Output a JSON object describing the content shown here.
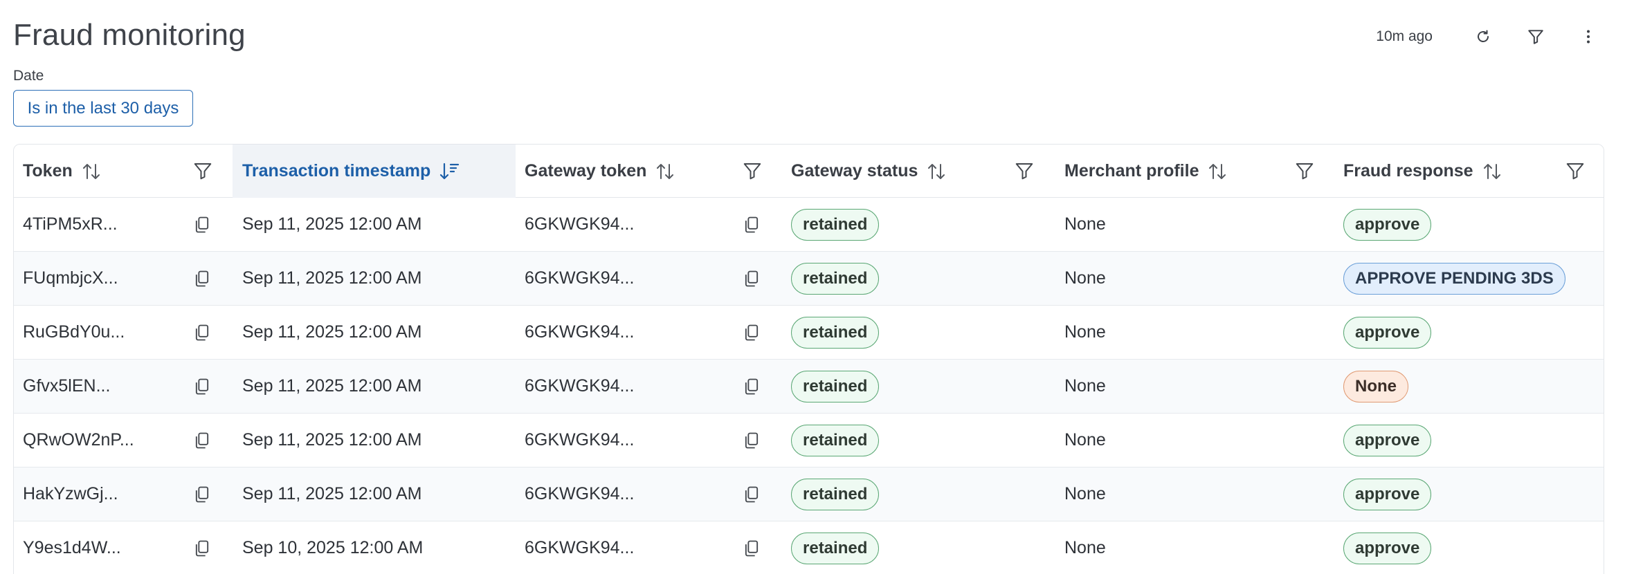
{
  "header": {
    "title": "Fraud monitoring",
    "updated": "10m ago",
    "refresh_icon": "refresh-icon",
    "filter_icon": "filter-icon",
    "more_icon": "more-vertical-icon"
  },
  "filters": {
    "date_label": "Date",
    "date_value": "Is in the last 30 days"
  },
  "table": {
    "columns": [
      {
        "key": "token",
        "label": "Token"
      },
      {
        "key": "timestamp",
        "label": "Transaction timestamp"
      },
      {
        "key": "gateway_token",
        "label": "Gateway token"
      },
      {
        "key": "gateway_status",
        "label": "Gateway status"
      },
      {
        "key": "merchant_profile",
        "label": "Merchant profile"
      },
      {
        "key": "fraud_response",
        "label": "Fraud response"
      }
    ],
    "rows": [
      {
        "token": "4TiPM5xR...",
        "timestamp": "Sep 11, 2025 12:00 AM",
        "gateway_token": "6GKWGK94...",
        "gateway_status": "retained",
        "merchant_profile": "None",
        "fraud_response": "approve",
        "fraud_kind": "approve"
      },
      {
        "token": "FUqmbjcX...",
        "timestamp": "Sep 11, 2025 12:00 AM",
        "gateway_token": "6GKWGK94...",
        "gateway_status": "retained",
        "merchant_profile": "None",
        "fraud_response": "APPROVE PENDING 3DS",
        "fraud_kind": "pending"
      },
      {
        "token": "RuGBdY0u...",
        "timestamp": "Sep 11, 2025 12:00 AM",
        "gateway_token": "6GKWGK94...",
        "gateway_status": "retained",
        "merchant_profile": "None",
        "fraud_response": "approve",
        "fraud_kind": "approve"
      },
      {
        "token": "Gfvx5lEN...",
        "timestamp": "Sep 11, 2025 12:00 AM",
        "gateway_token": "6GKWGK94...",
        "gateway_status": "retained",
        "merchant_profile": "None",
        "fraud_response": "None",
        "fraud_kind": "none"
      },
      {
        "token": "QRwOW2nP...",
        "timestamp": "Sep 11, 2025 12:00 AM",
        "gateway_token": "6GKWGK94...",
        "gateway_status": "retained",
        "merchant_profile": "None",
        "fraud_response": "approve",
        "fraud_kind": "approve"
      },
      {
        "token": "HakYzwGj...",
        "timestamp": "Sep 11, 2025 12:00 AM",
        "gateway_token": "6GKWGK94...",
        "gateway_status": "retained",
        "merchant_profile": "None",
        "fraud_response": "approve",
        "fraud_kind": "approve"
      },
      {
        "token": "Y9es1d4W...",
        "timestamp": "Sep 10, 2025 12:00 AM",
        "gateway_token": "6GKWGK94...",
        "gateway_status": "retained",
        "merchant_profile": "None",
        "fraud_response": "approve",
        "fraud_kind": "approve"
      }
    ]
  }
}
